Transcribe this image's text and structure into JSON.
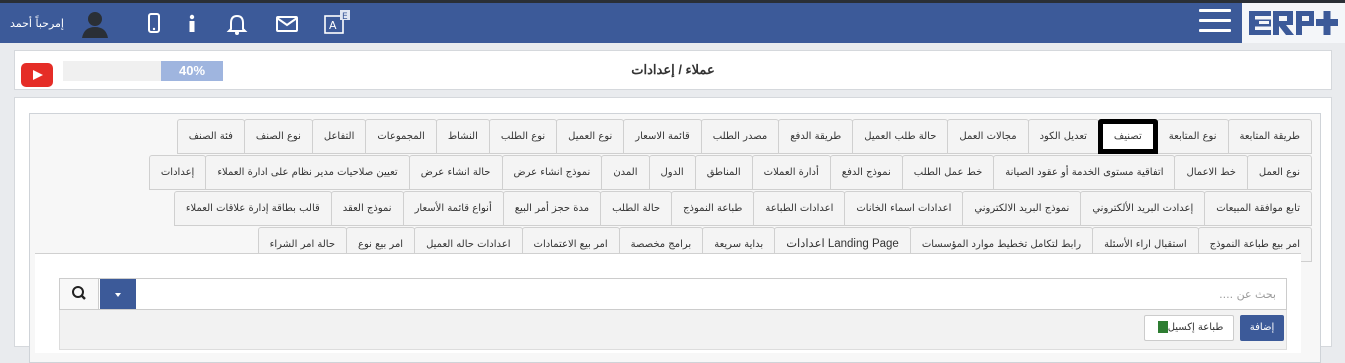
{
  "header": {
    "greeting": "إمرحباً أحمد",
    "icons": [
      "user-icon",
      "mobile-icon",
      "info-icon",
      "bell-icon",
      "envelope-icon",
      "language-icon"
    ],
    "language_badge": "E",
    "brand_color": "#3c5a99"
  },
  "page": {
    "progress": "40%",
    "progress_value": 0.4,
    "breadcrumb": "عملاء / إعدادات"
  },
  "tabs": {
    "row1": [
      "طريقة المتابعة",
      "نوع المتابعة",
      "تصنيف",
      "تعديل الكود",
      "مجالات العمل",
      "حالة طلب العميل",
      "طريقة الدفع",
      "مصدر الطلب",
      "قائمة الاسعار",
      "نوع العميل",
      "نوع الطلب",
      "النشاط",
      "المجموعات",
      "التفاعل",
      "نوع الصنف",
      "فئة الصنف"
    ],
    "row2": [
      "نوع العمل",
      "خط الاعمال",
      "اتفاقية مستوى الخدمة أو عقود الصيانة",
      "خط عمل الطلب",
      "نموذج الدفع",
      "أدارة العملات",
      "المناطق",
      "الدول",
      "المدن",
      "نموذج انشاء عرض",
      "حالة انشاء عرض",
      "تعيين صلاحيات مدير نظام على ادارة العملاء",
      "إعدادات"
    ],
    "row3": [
      "تابع موافقة المبيعات",
      "إعدادت البريد الألكتروني",
      "نموذج البريد الالكتروني",
      "اعدادات اسماء الخانات",
      "اعدادات الطباعة",
      "طباعة النموذج",
      "حالة الطلب",
      "مدة حجز أمر البيع",
      "أنواع قائمة الأسعار",
      "نموذج العقد",
      "قالب بطاقة إدارة علاقات العملاء"
    ],
    "row4": [
      "امر بيع طباعة النموذج",
      "استقبال اراء الأسئلة",
      "رابط لتكامل تخطيط موارد المؤسسات",
      "اعدادات Landing Page",
      "بداية سريعة",
      "برامج مخصصة",
      "امر بيع الاعتمادات",
      "اعدادات حاله العميل",
      "امر بيع نوع",
      "حالة امر الشراء"
    ],
    "active": "تصنيف"
  },
  "search": {
    "placeholder": "بحث عن ...."
  },
  "toolbar": {
    "add_label": "إضافة",
    "excel_label": "طباعة إكسيل"
  }
}
